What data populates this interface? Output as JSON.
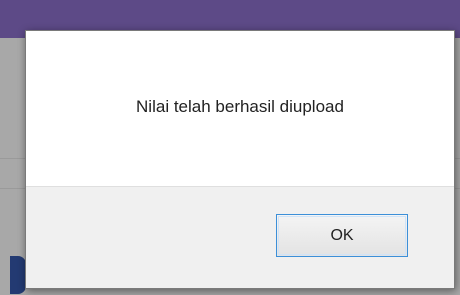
{
  "dialog": {
    "message": "Nilai telah berhasil diupload",
    "ok_label": "OK"
  },
  "colors": {
    "header_bar": "#5d4a87",
    "overlay": "#a8a8a8",
    "dialog_footer": "#f0f0f0",
    "button_focus_border": "#3c8fd8"
  }
}
